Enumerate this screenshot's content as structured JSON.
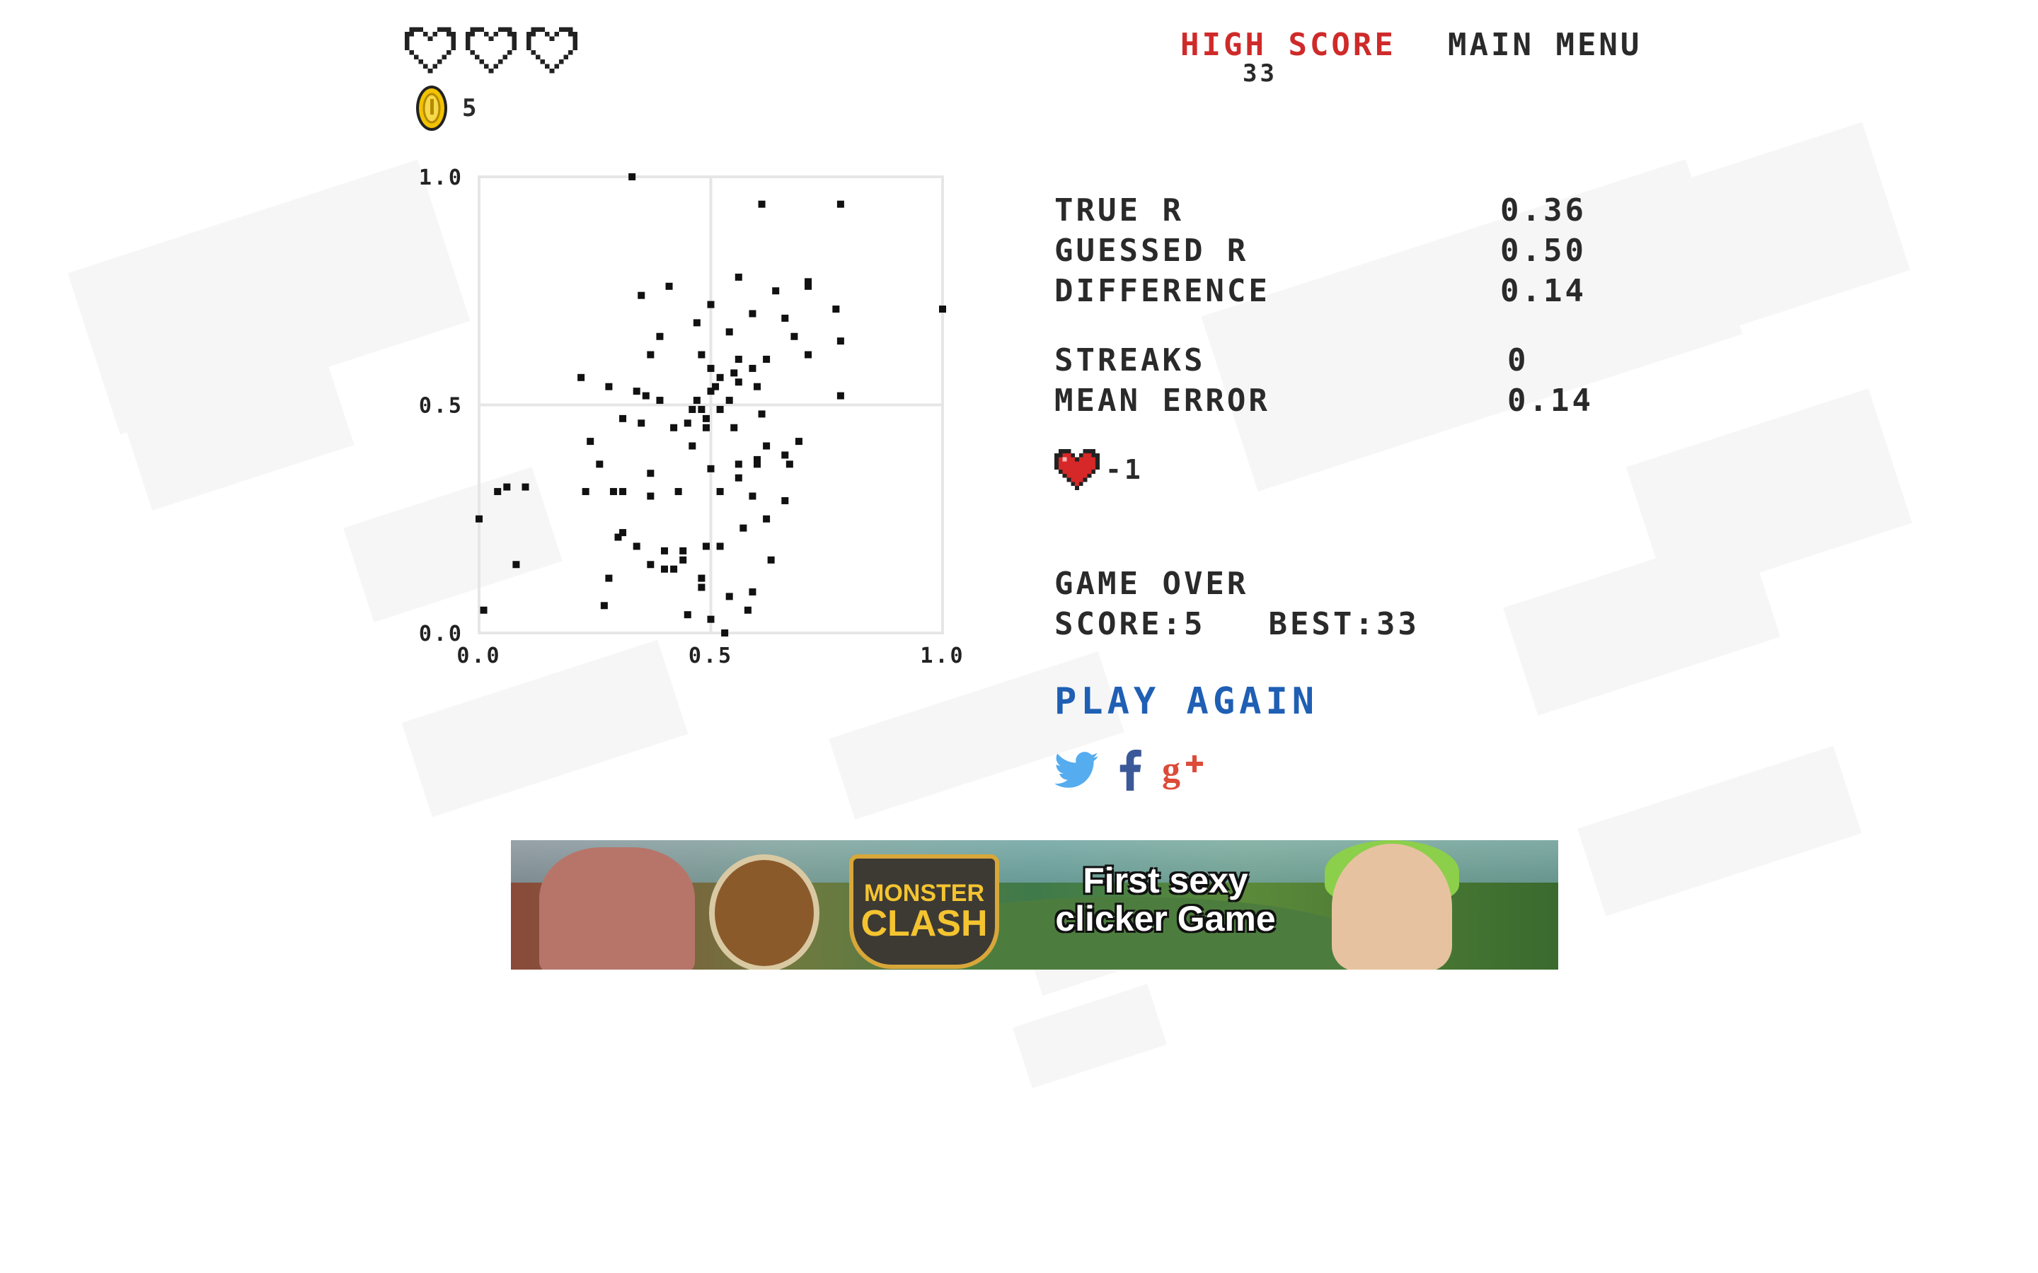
{
  "lives": {
    "count": 3
  },
  "coins": {
    "count": "5"
  },
  "header": {
    "high_score_label": "HIGH SCORE",
    "high_score_value": "33",
    "main_menu_label": "MAIN MENU"
  },
  "stats": {
    "true_r_label": "TRUE R",
    "true_r_value": "0.36",
    "guessed_r_label": "GUESSED R",
    "guessed_r_value": "0.50",
    "difference_label": "DIFFERENCE",
    "difference_value": "0.14",
    "streaks_label": "STREAKS",
    "streaks_value": "0",
    "mean_error_label": "MEAN ERROR",
    "mean_error_value": "0.14"
  },
  "heart_delta": {
    "text": "-1"
  },
  "game_over": {
    "title": "GAME OVER",
    "score_label": "SCORE:",
    "score_value": "5",
    "best_label": "BEST:",
    "best_value": "33"
  },
  "play_again_label": "PLAY AGAIN",
  "social": {
    "icons": [
      "twitter-icon",
      "facebook-icon",
      "google-plus-icon"
    ]
  },
  "ad": {
    "logo_top": "MONSTER",
    "logo_bottom": "CLASH",
    "tagline": "First sexy clicker Game"
  },
  "colors": {
    "high_score": "#cf2a2a",
    "play_again": "#1f5fb4",
    "heart": "#d62828",
    "coin": "#f2c200",
    "twitter": "#55acee",
    "facebook": "#3b5998",
    "google_plus": "#dd4b39"
  },
  "chart_data": {
    "type": "scatter",
    "xlim": [
      0,
      1
    ],
    "ylim": [
      0,
      1
    ],
    "x_ticks": [
      "0.0",
      "0.5",
      "1.0"
    ],
    "y_ticks": [
      "0.0",
      "0.5",
      "1.0"
    ],
    "grid": "midlines",
    "points": [
      [
        0.33,
        1.0
      ],
      [
        0.61,
        0.94
      ],
      [
        0.78,
        0.94
      ],
      [
        1.0,
        0.71
      ],
      [
        0.35,
        0.74
      ],
      [
        0.41,
        0.76
      ],
      [
        0.56,
        0.78
      ],
      [
        0.64,
        0.75
      ],
      [
        0.71,
        0.76
      ],
      [
        0.71,
        0.77
      ],
      [
        0.5,
        0.72
      ],
      [
        0.59,
        0.7
      ],
      [
        0.66,
        0.69
      ],
      [
        0.77,
        0.71
      ],
      [
        0.47,
        0.68
      ],
      [
        0.39,
        0.65
      ],
      [
        0.54,
        0.66
      ],
      [
        0.68,
        0.65
      ],
      [
        0.78,
        0.64
      ],
      [
        0.37,
        0.61
      ],
      [
        0.48,
        0.61
      ],
      [
        0.56,
        0.6
      ],
      [
        0.62,
        0.6
      ],
      [
        0.71,
        0.61
      ],
      [
        0.5,
        0.58
      ],
      [
        0.59,
        0.58
      ],
      [
        0.22,
        0.56
      ],
      [
        0.55,
        0.57
      ],
      [
        0.52,
        0.56
      ],
      [
        0.56,
        0.55
      ],
      [
        0.51,
        0.54
      ],
      [
        0.6,
        0.54
      ],
      [
        0.28,
        0.54
      ],
      [
        0.34,
        0.53
      ],
      [
        0.36,
        0.52
      ],
      [
        0.39,
        0.51
      ],
      [
        0.47,
        0.51
      ],
      [
        0.5,
        0.53
      ],
      [
        0.54,
        0.51
      ],
      [
        0.78,
        0.52
      ],
      [
        0.46,
        0.49
      ],
      [
        0.48,
        0.49
      ],
      [
        0.52,
        0.49
      ],
      [
        0.61,
        0.48
      ],
      [
        0.31,
        0.47
      ],
      [
        0.35,
        0.46
      ],
      [
        0.42,
        0.45
      ],
      [
        0.45,
        0.46
      ],
      [
        0.49,
        0.47
      ],
      [
        0.49,
        0.45
      ],
      [
        0.55,
        0.45
      ],
      [
        0.24,
        0.42
      ],
      [
        0.46,
        0.41
      ],
      [
        0.62,
        0.41
      ],
      [
        0.69,
        0.42
      ],
      [
        0.6,
        0.38
      ],
      [
        0.66,
        0.39
      ],
      [
        0.67,
        0.37
      ],
      [
        0.26,
        0.37
      ],
      [
        0.5,
        0.36
      ],
      [
        0.56,
        0.37
      ],
      [
        0.6,
        0.37
      ],
      [
        0.37,
        0.35
      ],
      [
        0.56,
        0.34
      ],
      [
        0.04,
        0.31
      ],
      [
        0.06,
        0.32
      ],
      [
        0.1,
        0.32
      ],
      [
        0.23,
        0.31
      ],
      [
        0.29,
        0.31
      ],
      [
        0.31,
        0.31
      ],
      [
        0.37,
        0.3
      ],
      [
        0.43,
        0.31
      ],
      [
        0.52,
        0.31
      ],
      [
        0.59,
        0.3
      ],
      [
        0.66,
        0.29
      ],
      [
        0.0,
        0.25
      ],
      [
        0.62,
        0.25
      ],
      [
        0.57,
        0.23
      ],
      [
        0.3,
        0.21
      ],
      [
        0.31,
        0.22
      ],
      [
        0.34,
        0.19
      ],
      [
        0.4,
        0.18
      ],
      [
        0.44,
        0.18
      ],
      [
        0.44,
        0.16
      ],
      [
        0.49,
        0.19
      ],
      [
        0.52,
        0.19
      ],
      [
        0.63,
        0.16
      ],
      [
        0.08,
        0.15
      ],
      [
        0.37,
        0.15
      ],
      [
        0.4,
        0.14
      ],
      [
        0.42,
        0.14
      ],
      [
        0.28,
        0.12
      ],
      [
        0.48,
        0.12
      ],
      [
        0.48,
        0.1
      ],
      [
        0.54,
        0.08
      ],
      [
        0.59,
        0.09
      ],
      [
        0.27,
        0.06
      ],
      [
        0.01,
        0.05
      ],
      [
        0.45,
        0.04
      ],
      [
        0.5,
        0.03
      ],
      [
        0.58,
        0.05
      ],
      [
        0.53,
        0.0
      ]
    ]
  }
}
